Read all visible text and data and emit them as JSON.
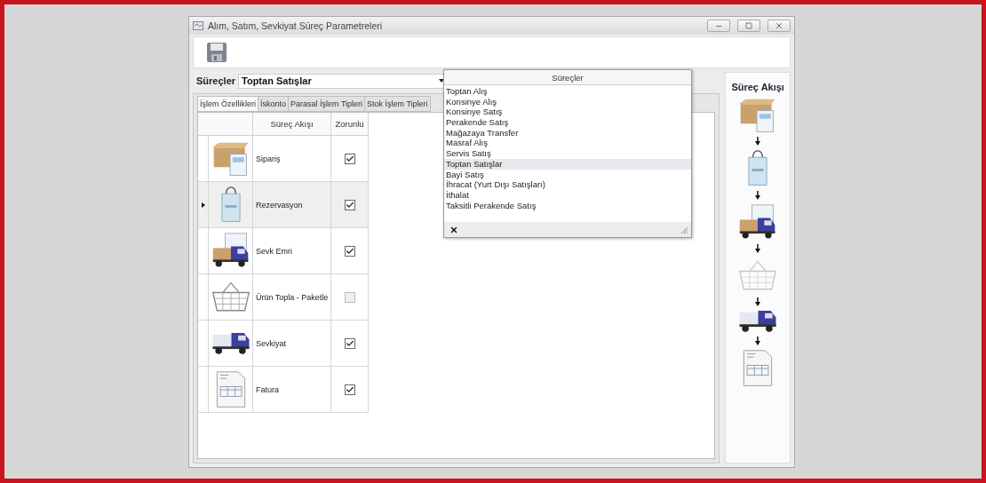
{
  "window": {
    "title": "Alım, Satım, Sevkiyat Süreç Parametreleri"
  },
  "selector": {
    "label": "Süreçler",
    "value": "Toptan Satışlar"
  },
  "tabs": [
    {
      "label": "İşlem Özellikleri",
      "selected": true
    },
    {
      "label": "İskonto",
      "selected": false
    },
    {
      "label": "Parasal İşlem Tipleri",
      "selected": false
    },
    {
      "label": "Stok İşlem Tipleri",
      "selected": false
    }
  ],
  "table": {
    "columns": [
      "Süreç Akışı",
      "Zorunlu"
    ],
    "rows": [
      {
        "kind": "order",
        "name": "Sipariş",
        "required": true,
        "selected": false
      },
      {
        "kind": "reservation",
        "name": "Rezervasyon",
        "required": true,
        "selected": true
      },
      {
        "kind": "dispatch",
        "name": "Sevk Emri",
        "required": true,
        "selected": false
      },
      {
        "kind": "picking",
        "name": "Ürün Topla - Paketle",
        "required": false,
        "selected": false
      },
      {
        "kind": "shipment",
        "name": "Sevkiyat",
        "required": true,
        "selected": false
      },
      {
        "kind": "invoice",
        "name": "Fatura",
        "required": true,
        "selected": false
      }
    ]
  },
  "flow_panel": {
    "title": "Süreç Akışı"
  },
  "dropdown": {
    "header": "Süreçler",
    "items": [
      {
        "label": "Toptan Alış",
        "selected": false
      },
      {
        "label": "Konsinye Alış",
        "selected": false
      },
      {
        "label": "Konsinye Satış",
        "selected": false
      },
      {
        "label": "Perakende Satış",
        "selected": false
      },
      {
        "label": "Mağazaya Transfer",
        "selected": false
      },
      {
        "label": "Masraf Alış",
        "selected": false
      },
      {
        "label": "Servis Satış",
        "selected": false
      },
      {
        "label": "Toptan Satışlar",
        "selected": true
      },
      {
        "label": "Bayi Satış",
        "selected": false
      },
      {
        "label": "İhracat (Yurt Dışı Satışları)",
        "selected": false
      },
      {
        "label": "İthalat",
        "selected": false
      },
      {
        "label": "Taksitli Perakende Satış",
        "selected": false
      }
    ]
  }
}
